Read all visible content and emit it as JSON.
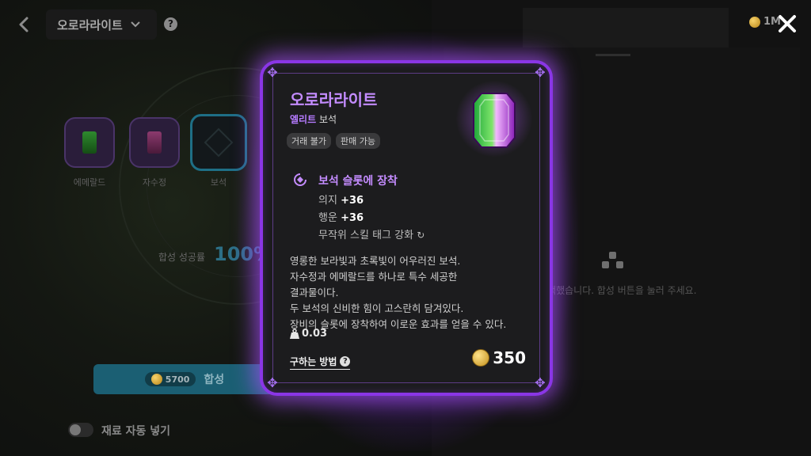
{
  "header": {
    "back_icon": "chevron-left-icon",
    "category_dropdown": "오로라라이트",
    "currency_amount": "1M",
    "close_icon": "close-icon"
  },
  "synthesis": {
    "slots": [
      {
        "label": "에메랄드",
        "gem_color": "#2e8a2e"
      },
      {
        "label": "자수정",
        "gem_color": "#8c3a6e"
      },
      {
        "label": "보석",
        "gem_color": ""
      }
    ],
    "rate_label": "합성 성공률",
    "rate_value": "100%",
    "cost": "5700",
    "button_label": "합성",
    "auto_fill_label": "재료 자동 넣기"
  },
  "right_panel": {
    "hint_text": "선택했습니다. 합성 버튼을 눌러 주세요."
  },
  "tooltip": {
    "name": "오로라라이트",
    "grade_prefix": "엘리트",
    "grade_suffix": "보석",
    "tags": [
      "거래 불가",
      "판매 가능"
    ],
    "equip_title": "보석 슬롯에 장착",
    "stats": [
      {
        "label": "의지",
        "value": "+36"
      },
      {
        "label": "행운",
        "value": "+36"
      }
    ],
    "special_stat": "무작위 스킬 태그 강화",
    "description": [
      "영롱한 보라빛과 초록빛이 어우러진 보석.",
      "자수정과 에메랄드를 하나로 특수 세공한",
      "결과물이다.",
      "두 보석의 신비한 힘이 고스란히 담겨있다.",
      "장비의 슬롯에 장착하여 이로운 효과를 얻을 수 있다."
    ],
    "weight": "0.03",
    "how_to_obtain": "구하는 방법",
    "price": "350",
    "accent_color": "#8a36e6"
  }
}
